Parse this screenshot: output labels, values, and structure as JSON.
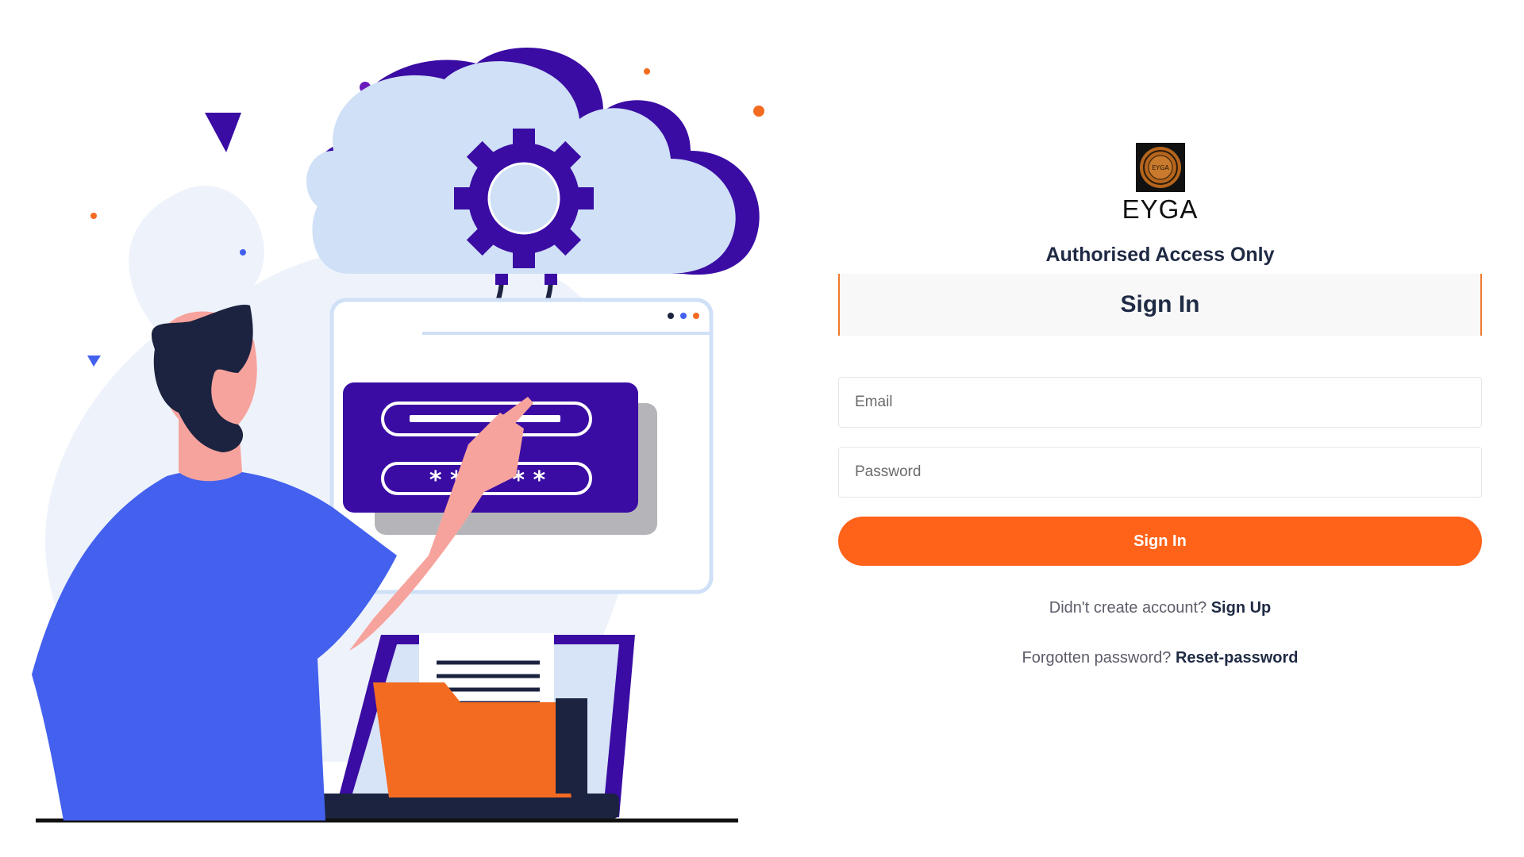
{
  "brand": {
    "name": "EYGA",
    "logo_text": "EYGA"
  },
  "tagline": "Authorised Access Only",
  "form": {
    "header": "Sign In",
    "email": {
      "placeholder": "Email",
      "value": ""
    },
    "password": {
      "placeholder": "Password",
      "value": ""
    },
    "submit_label": "Sign In"
  },
  "links": {
    "signup_prompt": "Didn't create account?",
    "signup_label": "Sign Up",
    "reset_prompt": "Forgotten password?",
    "reset_label": "Reset-password"
  },
  "illustration": {
    "password_mask": "* * * * * *"
  },
  "colors": {
    "accent": "#ff6219",
    "header_border": "#f07a2e",
    "heading_text": "#1f2a44",
    "illustration_purple": "#3a0ca3",
    "illustration_blue": "#4361ee",
    "illustration_cloud": "#cfe0f7"
  },
  "icons": {
    "logo": "eyga-seal-logo",
    "illustration": "cloud-login-illustration"
  }
}
